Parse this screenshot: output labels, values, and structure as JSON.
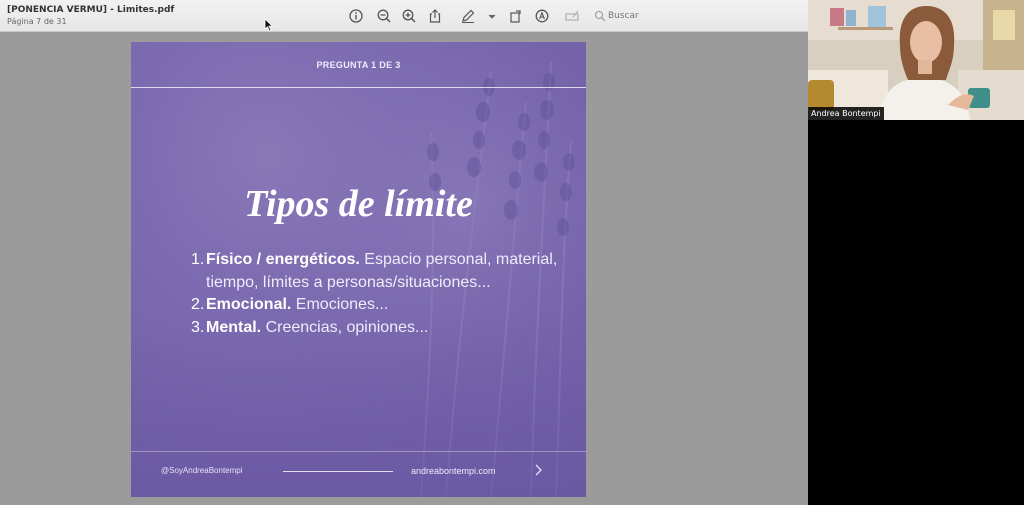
{
  "viewer": {
    "title": "[PONENCIA VERMU] - Limites.pdf",
    "page_info": "Página 7 de 31",
    "search_placeholder": "Buscar",
    "toolbar_icons": [
      "info-icon",
      "zoom-out-icon",
      "zoom-in-icon",
      "share-icon",
      "markup-pen-icon",
      "chevron-down-icon",
      "rotate-icon",
      "annotate-circle-icon",
      "form-fill-icon",
      "search-icon"
    ]
  },
  "slide": {
    "header": "PREGUNTA 1 DE 3",
    "title": "Tipos de límite",
    "items": [
      {
        "num": "1.",
        "bold": "Físico / energéticos.",
        "rest": " Espacio personal, material, tiempo, límites a personas/situaciones..."
      },
      {
        "num": "2.",
        "bold": "Emocional.",
        "rest": " Emociones..."
      },
      {
        "num": "3.",
        "bold": "Mental.",
        "rest": " Creencias, opiniones..."
      }
    ],
    "handle": "@SoyAndreaBontempi",
    "website": "andreabontempi.com",
    "colors": {
      "background": "#7563aa",
      "text": "#ffffff"
    }
  },
  "video": {
    "participant_name": "Andrea Bontempi"
  }
}
